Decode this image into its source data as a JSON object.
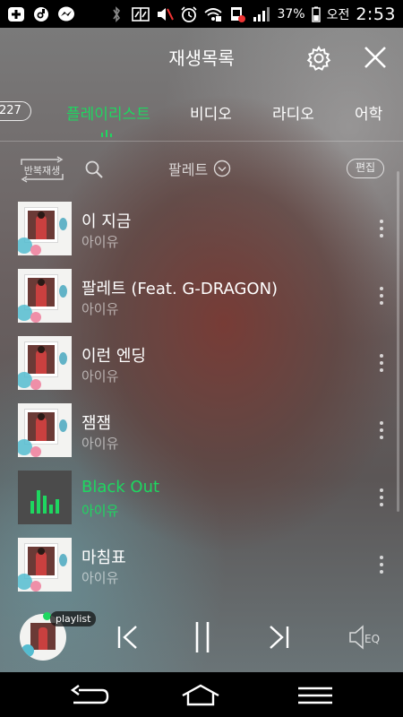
{
  "statusbar": {
    "battery": "37%",
    "ampm": "오전",
    "time": "2:53"
  },
  "header": {
    "title": "재생목록",
    "settings_icon": "gear-icon",
    "close_icon": "close-icon"
  },
  "tabs": {
    "count_pill": "227",
    "items": [
      {
        "label": "플레이리스트",
        "active": true
      },
      {
        "label": "비디오",
        "active": false
      },
      {
        "label": "라디오",
        "active": false
      },
      {
        "label": "어학",
        "active": false
      }
    ]
  },
  "controls": {
    "repeat_label": "반복재생",
    "playlist_name": "팔레트",
    "edit_label": "편집"
  },
  "songs": [
    {
      "title": "이 지금",
      "artist": "아이유",
      "playing": false
    },
    {
      "title": "팔레트 (Feat. G-DRAGON)",
      "artist": "아이유",
      "playing": false
    },
    {
      "title": "이런 엔딩",
      "artist": "아이유",
      "playing": false
    },
    {
      "title": "잼잼",
      "artist": "아이유",
      "playing": false
    },
    {
      "title": "Black Out",
      "artist": "아이유",
      "playing": true
    },
    {
      "title": "마침표",
      "artist": "아이유",
      "playing": false
    }
  ],
  "player": {
    "badge": "playlist",
    "eq_label": "EQ"
  },
  "colors": {
    "accent": "#1ed760"
  }
}
